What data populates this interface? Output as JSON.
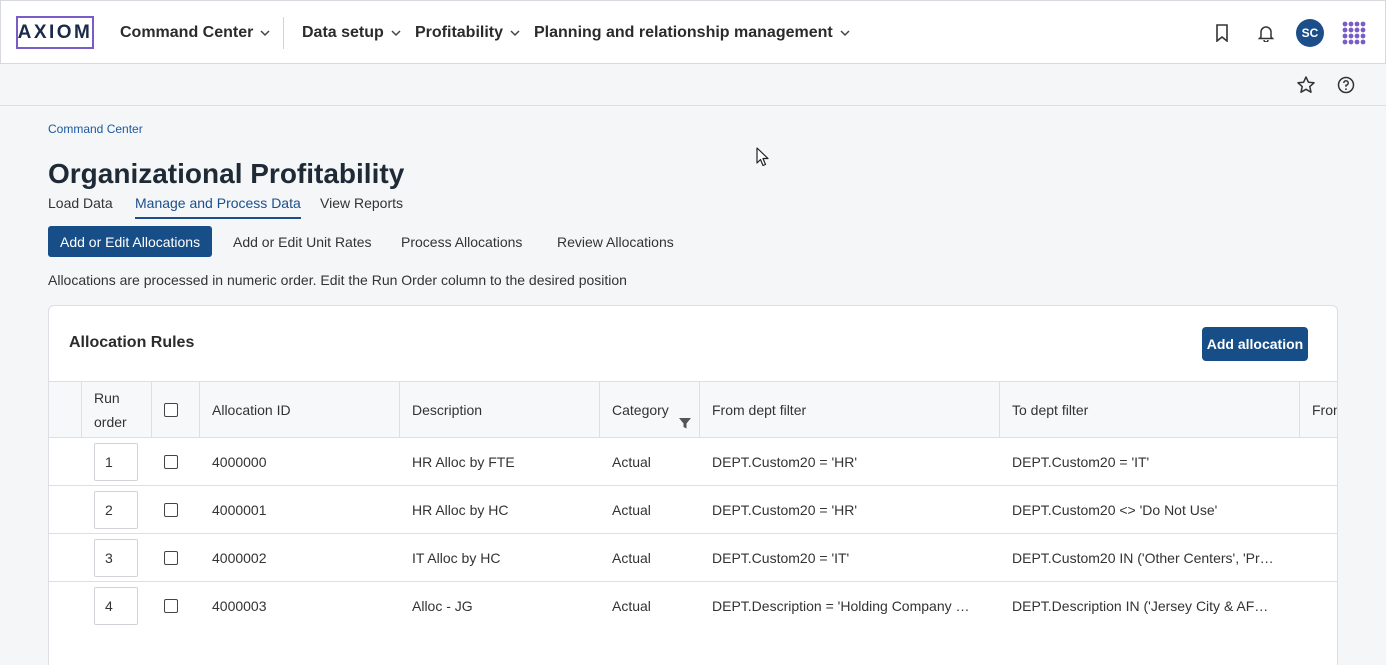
{
  "header": {
    "logo_text": "AXIOM",
    "nav": [
      {
        "label": "Command Center"
      },
      {
        "label": "Data setup"
      },
      {
        "label": "Profitability"
      },
      {
        "label": "Planning and relationship management"
      }
    ],
    "avatar_initials": "SC",
    "icons": [
      "bookmark-icon",
      "bell-icon",
      "apps-grid-icon"
    ]
  },
  "subbar": {
    "icons": [
      "star-icon",
      "help-icon"
    ]
  },
  "breadcrumb": "Command Center",
  "page_title": "Organizational Profitability",
  "tabs": [
    {
      "label": "Load Data",
      "active": false
    },
    {
      "label": "Manage and Process Data",
      "active": true
    },
    {
      "label": "View Reports",
      "active": false
    }
  ],
  "subtabs": [
    {
      "label": "Add or Edit Allocations",
      "active": true
    },
    {
      "label": "Add or Edit Unit Rates",
      "active": false
    },
    {
      "label": "Process Allocations",
      "active": false
    },
    {
      "label": "Review Allocations",
      "active": false
    }
  ],
  "help_text": "Allocations are processed in numeric order. Edit the Run Order column to the desired position",
  "card": {
    "title": "Allocation Rules",
    "add_button": "Add allocation",
    "columns": {
      "run_order_line1": "Run",
      "run_order_line2": "order",
      "allocation_id": "Allocation ID",
      "description": "Description",
      "category": "Category",
      "from_dept": "From dept filter",
      "to_dept": "To dept filter",
      "next_col": "From"
    },
    "rows": [
      {
        "run": "1",
        "id": "4000000",
        "desc": "HR Alloc by FTE",
        "cat": "Actual",
        "from": "DEPT.Custom20 = 'HR'",
        "to": "DEPT.Custom20 = 'IT'"
      },
      {
        "run": "2",
        "id": "4000001",
        "desc": "HR Alloc by HC",
        "cat": "Actual",
        "from": "DEPT.Custom20 = 'HR'",
        "to": "DEPT.Custom20 <> 'Do Not Use'"
      },
      {
        "run": "3",
        "id": "4000002",
        "desc": "IT Alloc by HC",
        "cat": "Actual",
        "from": "DEPT.Custom20 = 'IT'",
        "to": "DEPT.Custom20 IN ('Other Centers', 'Pr…"
      },
      {
        "run": "4",
        "id": "4000003",
        "desc": "Alloc - JG",
        "cat": "Actual",
        "from": "DEPT.Description = 'Holding Company …",
        "to": "DEPT.Description IN ('Jersey City & AF…"
      }
    ]
  },
  "colors": {
    "brand": "#174e87",
    "accent_purple": "#7a5cc7",
    "link": "#1c5aa0"
  }
}
